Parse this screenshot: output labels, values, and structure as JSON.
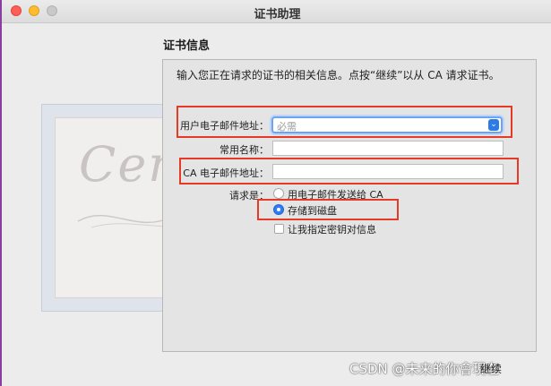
{
  "window": {
    "title": "证书助理"
  },
  "section": {
    "heading": "证书信息",
    "intro": "输入您正在请求的证书的相关信息。点按“继续”以从 CA 请求证书。"
  },
  "form": {
    "email_label": "用户电子邮件地址：",
    "email_placeholder": "必需",
    "common_name_label": "常用名称：",
    "common_name_value": "",
    "ca_email_label": "CA 电子邮件地址：",
    "ca_email_value": "",
    "request_label": "请求是：",
    "option_email": "用电子邮件发送给 CA",
    "option_disk": "存储到磁盘",
    "option_disk_selected": true,
    "option_keypair": "让我指定密钥对信息"
  },
  "actions": {
    "continue_label": "继续"
  },
  "watermark": "CSDN @未来的你會現在",
  "colors": {
    "highlight": "#e43a26",
    "accent": "#2f7cf6"
  }
}
